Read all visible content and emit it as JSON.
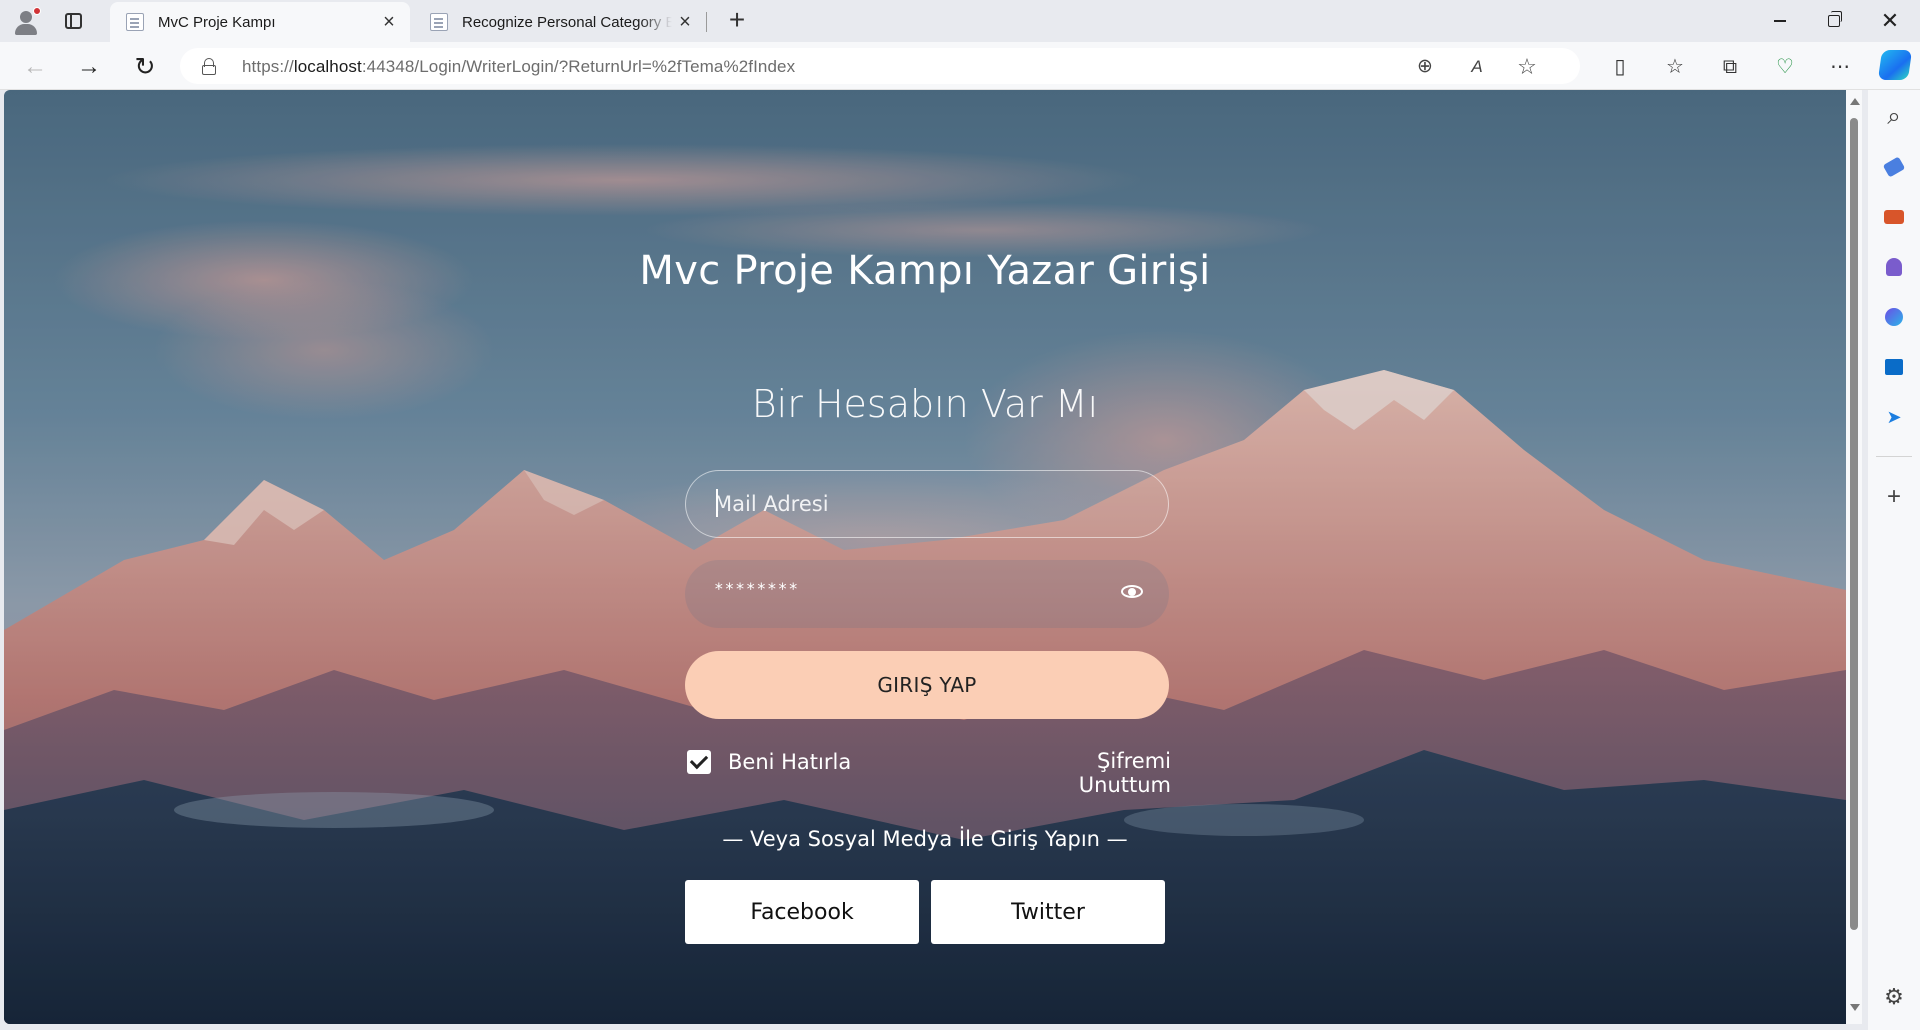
{
  "browser": {
    "tabs": [
      {
        "title": "MvC Proje Kampı",
        "active": true
      },
      {
        "title": "Recognize Personal Category Boo",
        "active": false
      }
    ],
    "close_glyph": "×",
    "new_tab_glyph": "+",
    "window_close_glyph": "✕",
    "url_prefix": "https://",
    "url_host": "localhost",
    "url_rest": ":44348/Login/WriterLogin/?ReturnUrl=%2fTema%2fIndex",
    "glyphs": {
      "back": "←",
      "forward": "→",
      "reload": "↻",
      "zoom": "⊕",
      "read_aloud": "A",
      "favorite": "☆",
      "split": "▯",
      "favorites": "☆",
      "collections": "⧉",
      "performance": "♡",
      "more": "⋯",
      "search": "⌕",
      "sidebar_add": "+",
      "settings": "⚙"
    },
    "accent_color": "#1a6ff0"
  },
  "page": {
    "title": "Mvc Proje Kampı Yazar Girişi",
    "form_heading": "Bir Hesabın Var Mı",
    "email_placeholder": "Mail Adresi",
    "password_mask": "********",
    "login_button": "GIRIŞ YAP",
    "remember_label": "Beni Hatırla",
    "remember_checked": true,
    "forgot_link": "Şifremi Unuttum",
    "social_text": "— Veya Sosyal Medya İle Giriş Yapın —",
    "facebook_button": "Facebook",
    "twitter_button": "Twitter",
    "button_color": "#fbceb5"
  },
  "sidebar_icons": [
    "search-icon",
    "tag-icon",
    "toolbox-icon",
    "games-icon",
    "m365-icon",
    "outlook-icon",
    "send-icon",
    "add-icon",
    "settings-icon"
  ]
}
